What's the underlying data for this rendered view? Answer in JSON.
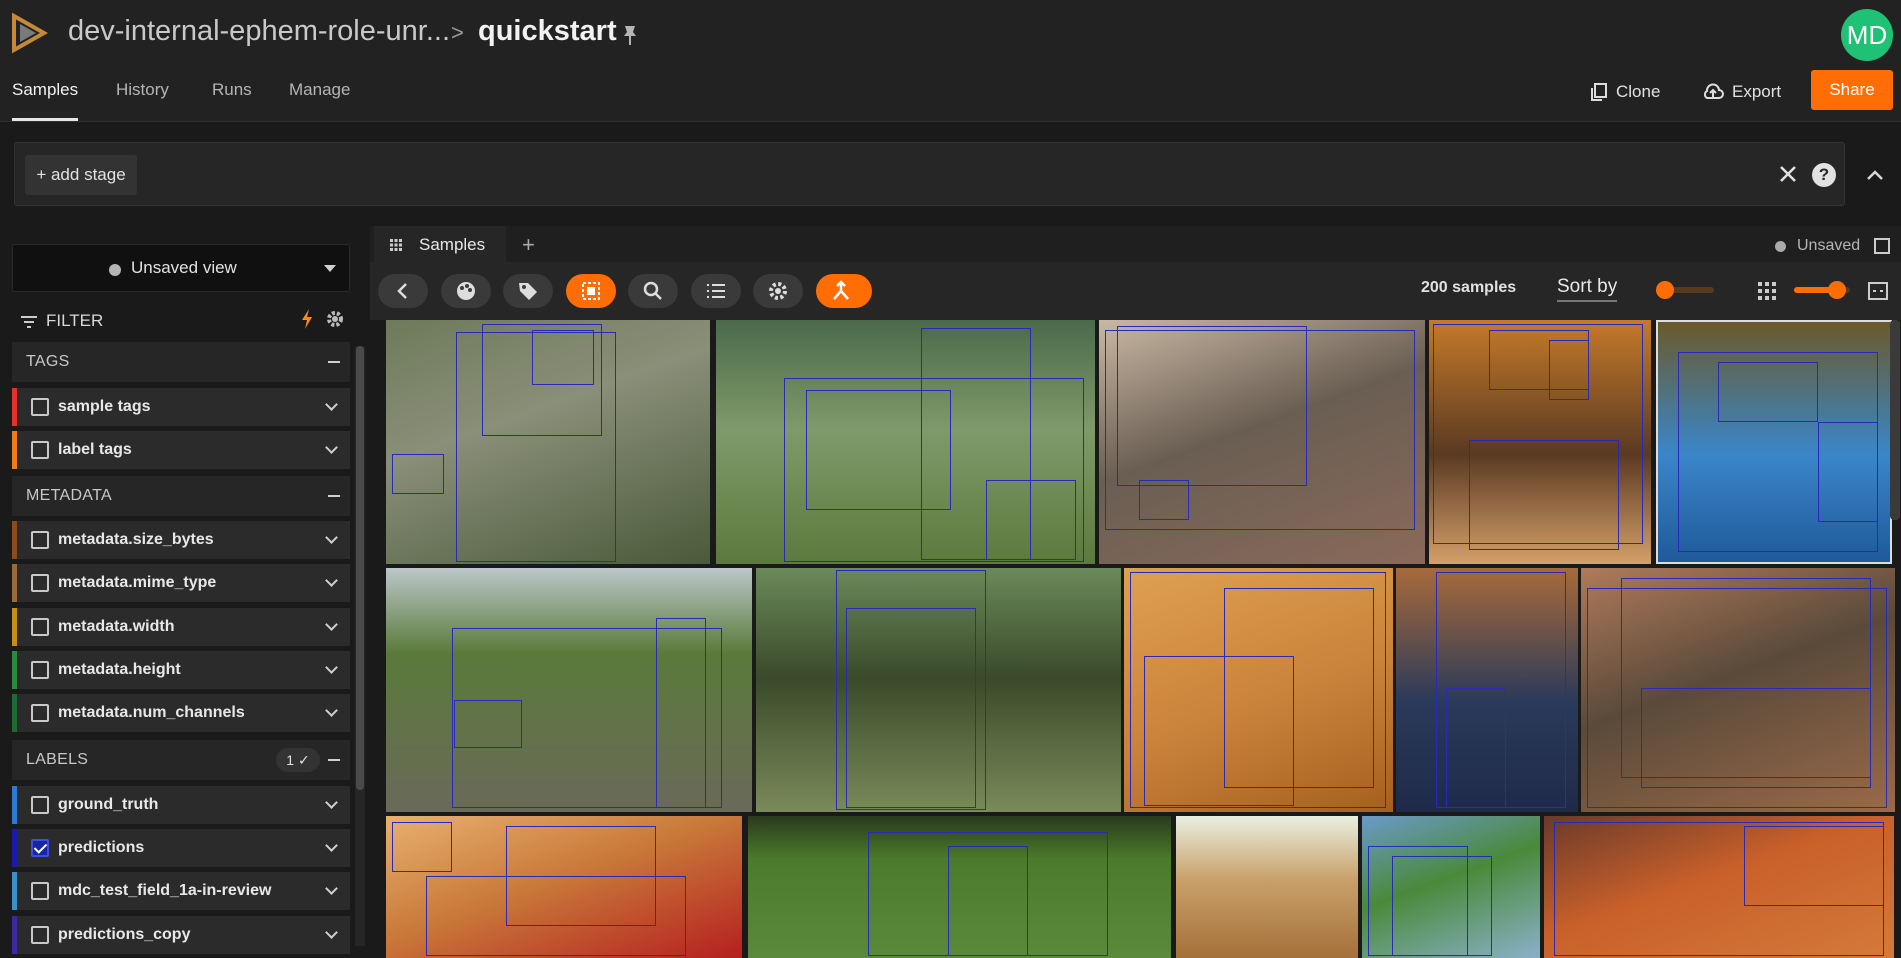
{
  "header": {
    "dataset_path": "dev-internal-ephem-role-unr...",
    "separator": ">",
    "dataset_name": "quickstart",
    "user_initials": "MD"
  },
  "nav": {
    "tabs": [
      {
        "label": "Samples",
        "active": true
      },
      {
        "label": "History",
        "active": false
      },
      {
        "label": "Runs",
        "active": false
      },
      {
        "label": "Manage",
        "active": false
      }
    ],
    "clone_label": "Clone",
    "export_label": "Export",
    "share_label": "Share"
  },
  "stages": {
    "add_label": "+ add stage"
  },
  "sidebar": {
    "view_label": "Unsaved view",
    "filter_label": "FILTER",
    "sections": {
      "tags": "TAGS",
      "metadata": "METADATA",
      "labels": "LABELS",
      "labels_badge": "1 ✓"
    },
    "tag_rows": [
      {
        "label": "sample tags",
        "color": "#e5312a",
        "checked": false
      },
      {
        "label": "label tags",
        "color": "#f07d1a",
        "checked": false
      }
    ],
    "metadata_rows": [
      {
        "label": "metadata.size_bytes",
        "color": "#8c4b1c",
        "checked": false
      },
      {
        "label": "metadata.mime_type",
        "color": "#9a6b3a",
        "checked": false
      },
      {
        "label": "metadata.width",
        "color": "#c5901a",
        "checked": false
      },
      {
        "label": "metadata.height",
        "color": "#2c8a3c",
        "checked": false
      },
      {
        "label": "metadata.num_channels",
        "color": "#1e6a34",
        "checked": false
      }
    ],
    "label_rows": [
      {
        "label": "ground_truth",
        "color": "#2e7bd6",
        "checked": false
      },
      {
        "label": "predictions",
        "color": "#1a1ab0",
        "checked": true
      },
      {
        "label": "mdc_test_field_1a-in-review",
        "color": "#3a90c9",
        "checked": false
      },
      {
        "label": "predictions_copy",
        "color": "#3b2a9e",
        "checked": false
      }
    ]
  },
  "panel": {
    "tab_label": "Samples",
    "tab_add": "+",
    "unsaved_label": "Unsaved",
    "sample_count": "200 samples",
    "sort_label": "Sort by",
    "toolbar_icons": [
      "back-icon",
      "palette-icon",
      "tag-icon",
      "select-icon",
      "search-icon",
      "list-icon",
      "settings-icon",
      "merge-icon"
    ]
  },
  "colors": {
    "accent": "#ff6d04",
    "avatar": "#1fc274",
    "bbox": "#2a2ab8"
  },
  "gallery": {
    "tiles": [
      {
        "name": "tile-bird",
        "bg": "linear-gradient(160deg,#6e7a5a,#8a8f78 40%,#4a5a3a)"
      },
      {
        "name": "tile-horse-rider",
        "bg": "linear-gradient(180deg,#4a6a4a,#7f9a6a 45%,#5c7a3e)"
      },
      {
        "name": "tile-cat-rug",
        "bg": "linear-gradient(160deg,#c9b8a3,#6a5e53 45%,#8a6a5a)"
      },
      {
        "name": "tile-dinner",
        "bg": "linear-gradient(180deg,#c57a2a,#5a3a22 55%,#d4a06a)"
      },
      {
        "name": "tile-cake",
        "bg": "linear-gradient(180deg,#6a5a2a,#3a86c9 55%,#1f5a9a)"
      },
      {
        "name": "tile-train",
        "bg": "linear-gradient(180deg,#bcc7c9,#5a7a3a 35%,#6a6a5a)"
      },
      {
        "name": "tile-cow",
        "bg": "linear-gradient(180deg,#6a8a5a,#3a4a2a 45%,#7a8a5a)"
      },
      {
        "name": "tile-orange-cat",
        "bg": "linear-gradient(160deg,#e0a050,#c9823a 55%,#a5601f)"
      },
      {
        "name": "tile-man-tie",
        "bg": "linear-gradient(180deg,#a86a3a,#2a3a5a 55%,#1f2a4a)"
      },
      {
        "name": "tile-cat-bowl",
        "bg": "linear-gradient(160deg,#b07a5a,#5a4a3a 45%,#9a6a4a)"
      },
      {
        "name": "tile-food-plate",
        "bg": "linear-gradient(160deg,#e8b070,#c97a3a 45%,#b5201f)"
      },
      {
        "name": "tile-dogs",
        "bg": "linear-gradient(180deg,#2a3a1f,#4a7a2a 30%,#5a8a3a)"
      },
      {
        "name": "tile-bear",
        "bg": "linear-gradient(180deg,#e8f0e0,#c9a06a 45%,#a5703a)"
      },
      {
        "name": "tile-teddy",
        "bg": "linear-gradient(160deg,#6a9ac9,#4a8a3a 45%,#8ab0c9)"
      },
      {
        "name": "tile-pizza",
        "bg": "linear-gradient(160deg,#6a3a2a,#c9602a 45%,#d47a3a)"
      }
    ]
  }
}
